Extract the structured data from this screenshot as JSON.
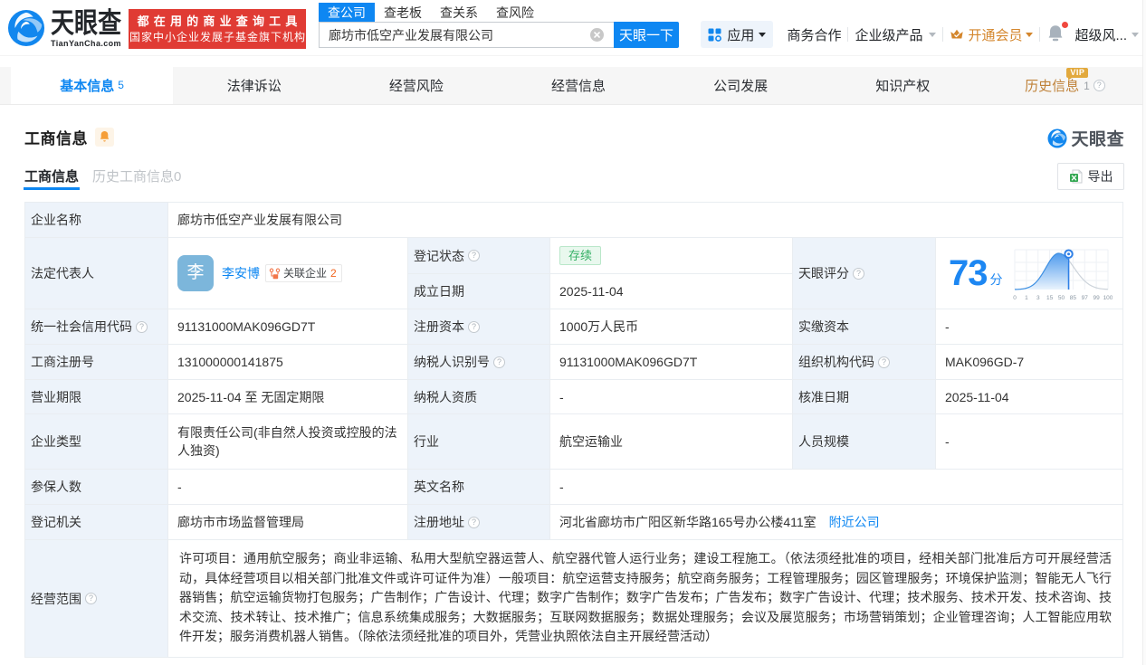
{
  "brand": {
    "logo_cn": "天眼查",
    "logo_en": "TianYanCha.com",
    "slogan_line1": "都在用的商业查询工具",
    "slogan_line2": "国家中小企业发展子基金旗下机构",
    "accent_color": "#0e87f2",
    "red_color": "#e03b34"
  },
  "search": {
    "tabs": [
      {
        "label": "查公司",
        "active": true
      },
      {
        "label": "查老板",
        "active": false
      },
      {
        "label": "查关系",
        "active": false
      },
      {
        "label": "查风险",
        "active": false
      }
    ],
    "value": "廊坊市低空产业发展有限公司",
    "button_label": "天眼一下"
  },
  "top_menu": {
    "apps": "应用",
    "cooperation": "商务合作",
    "enterprise_products": "企业级产品",
    "open_vip": "开通会员",
    "super_risk": "超级风..."
  },
  "nav_tabs": [
    {
      "label": "基本信息",
      "count": "5"
    },
    {
      "label": "法律诉讼",
      "count": ""
    },
    {
      "label": "经营风险",
      "count": ""
    },
    {
      "label": "经营信息",
      "count": ""
    },
    {
      "label": "公司发展",
      "count": ""
    },
    {
      "label": "知识产权",
      "count": ""
    },
    {
      "label": "历史信息",
      "count": "1"
    }
  ],
  "vip_badge": "VIP",
  "icons": {
    "question": "?",
    "avatar_char": "李"
  },
  "section": {
    "title": "工商信息",
    "subtab_active": "工商信息",
    "subtab_history": "历史工商信息0",
    "export_label": "导出",
    "watermark": "天眼查"
  },
  "table": {
    "company_name_label": "企业名称",
    "company_name": "廊坊市低空产业发展有限公司",
    "legal_rep_label": "法定代表人",
    "legal_rep_name": "李安博",
    "related_label": "关联企业",
    "related_count": "2",
    "reg_status_label": "登记状态",
    "reg_status": "存续",
    "est_date_label": "成立日期",
    "est_date": "2025-11-04",
    "score_label": "天眼评分",
    "credit_code_label": "统一社会信用代码",
    "credit_code": "91131000MAK096GD7T",
    "reg_capital_label": "注册资本",
    "reg_capital": "1000万人民币",
    "paid_capital_label": "实缴资本",
    "paid_capital": "-",
    "reg_number_label": "工商注册号",
    "reg_number": "131000000141875",
    "taxpayer_id_label": "纳税人识别号",
    "taxpayer_id": "91131000MAK096GD7T",
    "org_code_label": "组织机构代码",
    "org_code": "MAK096GD-7",
    "business_term_label": "营业期限",
    "business_term": "2025-11-04 至 无固定期限",
    "taxpayer_quality_label": "纳税人资质",
    "taxpayer_quality": "-",
    "approval_date_label": "核准日期",
    "approval_date": "2025-11-04",
    "company_type_label": "企业类型",
    "company_type": "有限责任公司(非自然人投资或控股的法人独资)",
    "industry_label": "行业",
    "industry": "航空运输业",
    "staff_size_label": "人员规模",
    "staff_size": "-",
    "insured_label": "参保人数",
    "insured": "-",
    "english_name_label": "英文名称",
    "english_name": "-",
    "reg_authority_label": "登记机关",
    "reg_authority": "廊坊市市场监督管理局",
    "reg_address_label": "注册地址",
    "reg_address": "河北省廊坊市广阳区新华路165号办公楼411室",
    "nearby_link": "附近公司",
    "business_scope_label": "经营范围",
    "business_scope": "许可项目：通用航空服务；商业非运输、私用大型航空器运营人、航空器代管人运行业务；建设工程施工。（依法须经批准的项目，经相关部门批准后方可开展经营活动，具体经营项目以相关部门批准文件或许可证件为准）一般项目：航空运营支持服务；航空商务服务；工程管理服务；园区管理服务；环境保护监测；智能无人飞行器销售；航空运输货物打包服务；广告制作；广告设计、代理；数字广告制作；数字广告发布；广告发布；数字广告设计、代理；技术服务、技术开发、技术咨询、技术交流、技术转让、技术推广；信息系统集成服务；大数据服务；互联网数据服务；数据处理服务；会议及展览服务；市场营销策划；企业管理咨询；人工智能应用软件开发；服务消费机器人销售。（除依法须经批准的项目外，凭营业执照依法自主开展经营活动）"
  },
  "chart_data": {
    "type": "area",
    "title": "天眼评分",
    "score": 73,
    "score_unit": "分",
    "x_ticks": [
      "0",
      "1",
      "3",
      "15",
      "50",
      "85",
      "97",
      "99",
      "100"
    ],
    "marker_fraction": 0.578,
    "curve": {
      "peak_fraction": 0.47,
      "sigma_left": 0.135,
      "sigma_right": 0.165
    },
    "ylabel": "",
    "xlabel": "",
    "legend": [],
    "description": "天眼评分 score distribution bell curve, company score 73 marked between ticks 50 and 85"
  }
}
